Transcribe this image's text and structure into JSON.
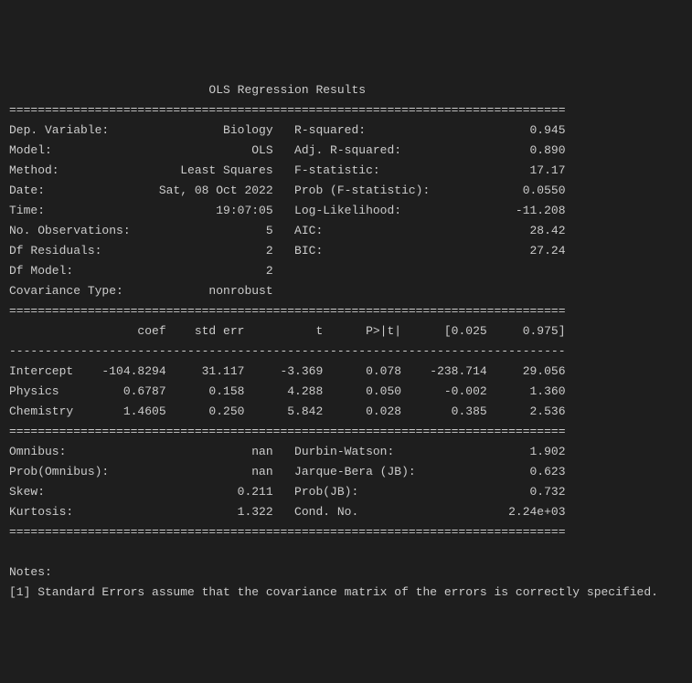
{
  "title": "OLS Regression Results",
  "sep_long": "==============================================================================",
  "sep_dash": "------------------------------------------------------------------------------",
  "left_block": [
    {
      "label": "Dep. Variable:",
      "value": "Biology"
    },
    {
      "label": "Model:",
      "value": "OLS"
    },
    {
      "label": "Method:",
      "value": "Least Squares"
    },
    {
      "label": "Date:",
      "value": "Sat, 08 Oct 2022"
    },
    {
      "label": "Time:",
      "value": "19:07:05"
    },
    {
      "label": "No. Observations:",
      "value": "5"
    },
    {
      "label": "Df Residuals:",
      "value": "2"
    },
    {
      "label": "Df Model:",
      "value": "2"
    },
    {
      "label": "Covariance Type:",
      "value": "nonrobust"
    }
  ],
  "right_block": [
    {
      "label": "R-squared:",
      "value": "0.945"
    },
    {
      "label": "Adj. R-squared:",
      "value": "0.890"
    },
    {
      "label": "F-statistic:",
      "value": "17.17"
    },
    {
      "label": "Prob (F-statistic):",
      "value": "0.0550"
    },
    {
      "label": "Log-Likelihood:",
      "value": "-11.208"
    },
    {
      "label": "AIC:",
      "value": "28.42"
    },
    {
      "label": "BIC:",
      "value": "27.24"
    }
  ],
  "coef_header": {
    "c1": "coef",
    "c2": "std err",
    "c3": "t",
    "c4": "P>|t|",
    "c5": "[0.025",
    "c6": "0.975]"
  },
  "coef_rows": [
    {
      "name": "Intercept",
      "coef": "-104.8294",
      "stderr": "31.117",
      "t": "-3.369",
      "p": "0.078",
      "lo": "-238.714",
      "hi": "29.056"
    },
    {
      "name": "Physics",
      "coef": "0.6787",
      "stderr": "0.158",
      "t": "4.288",
      "p": "0.050",
      "lo": "-0.002",
      "hi": "1.360"
    },
    {
      "name": "Chemistry",
      "coef": "1.4605",
      "stderr": "0.250",
      "t": "5.842",
      "p": "0.028",
      "lo": "0.385",
      "hi": "2.536"
    }
  ],
  "diag_left": [
    {
      "label": "Omnibus:",
      "value": "nan"
    },
    {
      "label": "Prob(Omnibus):",
      "value": "nan"
    },
    {
      "label": "Skew:",
      "value": "0.211"
    },
    {
      "label": "Kurtosis:",
      "value": "1.322"
    }
  ],
  "diag_right": [
    {
      "label": "Durbin-Watson:",
      "value": "1.902"
    },
    {
      "label": "Jarque-Bera (JB):",
      "value": "0.623"
    },
    {
      "label": "Prob(JB):",
      "value": "0.732"
    },
    {
      "label": "Cond. No.",
      "value": "2.24e+03"
    }
  ],
  "notes_header": "Notes:",
  "notes_line": "[1] Standard Errors assume that the covariance matrix of the errors is correctly specified."
}
